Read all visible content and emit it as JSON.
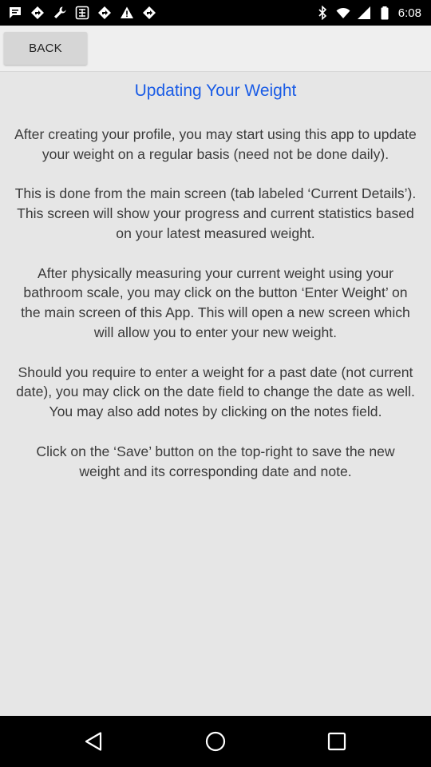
{
  "status_bar": {
    "time": "6:08",
    "left_icons": [
      "message-icon",
      "navigation-icon",
      "wrench-icon",
      "sports-icon",
      "navigation-icon",
      "warning-icon",
      "navigation-icon"
    ],
    "right_icons": [
      "bluetooth-icon",
      "wifi-icon",
      "signal-icon",
      "battery-icon"
    ]
  },
  "toolbar": {
    "back_label": "BACK"
  },
  "page": {
    "title": "Updating Your Weight",
    "paragraphs": [
      "After creating your profile, you may start using this app to update your weight on a regular basis (need not be done daily).",
      "This is done from the main screen (tab labeled ‘Current Details’). This screen will show your progress and current statistics based on your latest measured weight.",
      "After physically measuring your current weight using your bathroom scale, you may click on the button ‘Enter Weight’ on the main screen of this App. This will open a new screen which will allow you to enter your new weight.",
      "Should you require to enter a weight for a past date (not current date), you may click on the date field to change the date as well. You may also add notes by clicking on the notes field.",
      "Click on the ‘Save’ button on the top-right to save the new weight and its corresponding date and note."
    ]
  },
  "colors": {
    "title": "#1a5ce6",
    "background": "#e6e6e6",
    "text": "#3a3a3a",
    "button": "#d6d6d6"
  },
  "nav": {
    "icons": [
      "back-triangle-icon",
      "home-circle-icon",
      "recents-square-icon"
    ]
  }
}
